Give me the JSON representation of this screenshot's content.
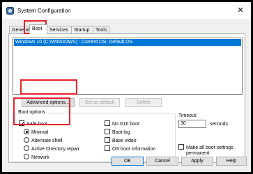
{
  "window": {
    "title": "System Configuration",
    "close_glyph": "✕"
  },
  "tabs": [
    {
      "label": "General"
    },
    {
      "label": "Boot"
    },
    {
      "label": "Services"
    },
    {
      "label": "Startup"
    },
    {
      "label": "Tools"
    }
  ],
  "os_list": {
    "entries": [
      "Windows 10 (C:\\WINDOWS) : Current OS; Default OS"
    ]
  },
  "buttons": {
    "advanced": "Advanced options...",
    "set_default": "Set as default",
    "delete": "Delete",
    "ok": "OK",
    "cancel": "Cancel",
    "apply": "Apply",
    "help": "Help"
  },
  "boot_options": {
    "title": "Boot options",
    "safe_boot": {
      "label": "Safe boot",
      "checked": true
    },
    "minimal": {
      "label": "Minimal",
      "checked": true
    },
    "alternate_shell": {
      "label": "Alternate shell",
      "checked": false
    },
    "active_directory_repair": {
      "label": "Active Directory repair",
      "checked": false
    },
    "network": {
      "label": "Network",
      "checked": false
    },
    "no_gui_boot": {
      "label": "No GUI boot",
      "checked": false
    },
    "boot_log": {
      "label": "Boot log",
      "checked": false
    },
    "base_video": {
      "label": "Base video",
      "checked": false
    },
    "os_boot_information": {
      "label": "OS boot information",
      "checked": false
    }
  },
  "timeout": {
    "label": "Timeout:",
    "value": "30",
    "unit": "seconds"
  },
  "permanent": {
    "label_line1": "Make all boot settings",
    "label_line2": "permanent",
    "checked": false
  },
  "colors": {
    "highlight": "#e8202a",
    "selection": "#0078d7"
  }
}
